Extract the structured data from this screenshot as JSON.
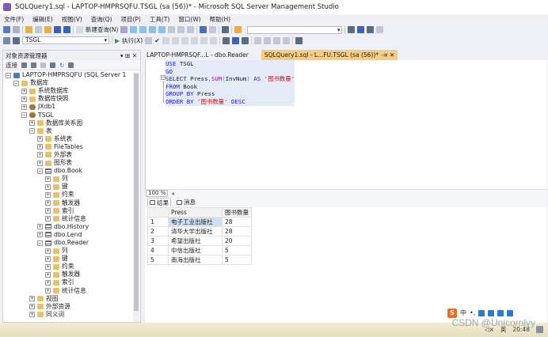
{
  "window": {
    "title": "SQLQuery1.sql - LAPTOP-HMPRSQFU.TSGL (sa (56))* - Microsoft SQL Server Management Studio"
  },
  "menu": [
    "文件(F)",
    "编辑(E)",
    "视图(V)",
    "查询(Q)",
    "项目(P)",
    "工具(T)",
    "窗口(W)",
    "帮助(H)"
  ],
  "toolbar": {
    "new_query": "新建查询(N)",
    "execute": "执行(X)",
    "database": "TSGL"
  },
  "object_explorer": {
    "title": "对象资源管理器",
    "controls": "▾ ⊞ ✕",
    "connect": "连接",
    "tree": [
      {
        "label": "LAPTOP-HMPRSQFU (SQL Server 1",
        "indent": 0,
        "exp": "−",
        "icon": "server"
      },
      {
        "label": "数据库",
        "indent": 1,
        "exp": "−",
        "icon": "folder"
      },
      {
        "label": "系统数据库",
        "indent": 2,
        "exp": "+",
        "icon": "folder"
      },
      {
        "label": "数据库快照",
        "indent": 2,
        "exp": "+",
        "icon": "folder"
      },
      {
        "label": "JXdb1",
        "indent": 2,
        "exp": "+",
        "icon": "db"
      },
      {
        "label": "TSGL",
        "indent": 2,
        "exp": "−",
        "icon": "db"
      },
      {
        "label": "数据库关系图",
        "indent": 3,
        "exp": "+",
        "icon": "folder"
      },
      {
        "label": "表",
        "indent": 3,
        "exp": "−",
        "icon": "folder"
      },
      {
        "label": "系统表",
        "indent": 4,
        "exp": "+",
        "icon": "folder"
      },
      {
        "label": "FileTables",
        "indent": 4,
        "exp": "+",
        "icon": "folder"
      },
      {
        "label": "外部表",
        "indent": 4,
        "exp": "+",
        "icon": "folder"
      },
      {
        "label": "图形表",
        "indent": 4,
        "exp": "+",
        "icon": "folder"
      },
      {
        "label": "dbo.Book",
        "indent": 4,
        "exp": "−",
        "icon": "table"
      },
      {
        "label": "列",
        "indent": 5,
        "exp": "+",
        "icon": "folder"
      },
      {
        "label": "键",
        "indent": 5,
        "exp": "+",
        "icon": "folder"
      },
      {
        "label": "约束",
        "indent": 5,
        "exp": "+",
        "icon": "folder"
      },
      {
        "label": "触发器",
        "indent": 5,
        "exp": "+",
        "icon": "folder"
      },
      {
        "label": "索引",
        "indent": 5,
        "exp": "+",
        "icon": "folder"
      },
      {
        "label": "统计信息",
        "indent": 5,
        "exp": "+",
        "icon": "folder"
      },
      {
        "label": "dbo.History",
        "indent": 4,
        "exp": "+",
        "icon": "table"
      },
      {
        "label": "dbo.Lend",
        "indent": 4,
        "exp": "+",
        "icon": "table"
      },
      {
        "label": "dbo.Reader",
        "indent": 4,
        "exp": "−",
        "icon": "table"
      },
      {
        "label": "列",
        "indent": 5,
        "exp": "+",
        "icon": "folder"
      },
      {
        "label": "键",
        "indent": 5,
        "exp": "+",
        "icon": "folder"
      },
      {
        "label": "约束",
        "indent": 5,
        "exp": "+",
        "icon": "folder"
      },
      {
        "label": "触发器",
        "indent": 5,
        "exp": "+",
        "icon": "folder"
      },
      {
        "label": "索引",
        "indent": 5,
        "exp": "+",
        "icon": "folder"
      },
      {
        "label": "统计信息",
        "indent": 5,
        "exp": "+",
        "icon": "folder"
      },
      {
        "label": "视图",
        "indent": 3,
        "exp": "+",
        "icon": "folder"
      },
      {
        "label": "外部资源",
        "indent": 3,
        "exp": "+",
        "icon": "folder"
      },
      {
        "label": "同义词",
        "indent": 3,
        "exp": "+",
        "icon": "folder"
      }
    ]
  },
  "tabs": [
    {
      "label": "LAPTOP-HMPRSQF...L - dbo.Reader",
      "active": false
    },
    {
      "label": "SQLQuery1.sql - L...FU.TSGL (sa (56))*",
      "active": true
    },
    {
      "label": "-¤ ✕",
      "active": true
    }
  ],
  "editor": {
    "lines": [
      [
        [
          "kw",
          "USE "
        ],
        [
          "",
          "TSGL"
        ]
      ],
      [
        [
          "kw",
          "GO"
        ]
      ],
      [
        [
          "kw",
          "SELECT "
        ],
        [
          "",
          "Press"
        ],
        [
          "gr",
          ","
        ],
        [
          "fn",
          "SUM"
        ],
        [
          "gr",
          "("
        ],
        [
          "",
          "InvNum"
        ],
        [
          "gr",
          ") "
        ],
        [
          "kw",
          "AS "
        ],
        [
          "str",
          "'图书数量'"
        ]
      ],
      [
        [
          "kw",
          "FROM "
        ],
        [
          "",
          "Book"
        ]
      ],
      [
        [
          "kw",
          "GROUP BY "
        ],
        [
          "",
          "Press"
        ]
      ],
      [
        [
          "kw",
          "ORDER BY "
        ],
        [
          "str",
          "'图书数量' "
        ],
        [
          "kw",
          "DESC"
        ]
      ]
    ]
  },
  "zoom": "100 %",
  "results": {
    "tab_results": "结果",
    "tab_messages": "消息",
    "columns": [
      "Press",
      "图书数量"
    ],
    "rows": [
      [
        "1",
        "电子工业出版社",
        "28"
      ],
      [
        "2",
        "清华大学出版社",
        "28"
      ],
      [
        "3",
        "希望出版社",
        "20"
      ],
      [
        "4",
        "中信出版社",
        "5"
      ],
      [
        "5",
        "南海出版社",
        "5"
      ]
    ]
  },
  "tray": {
    "ime": "中",
    "time": "20:48",
    "watermark": "CSDN @Unicornlyy",
    "lang": "英"
  }
}
